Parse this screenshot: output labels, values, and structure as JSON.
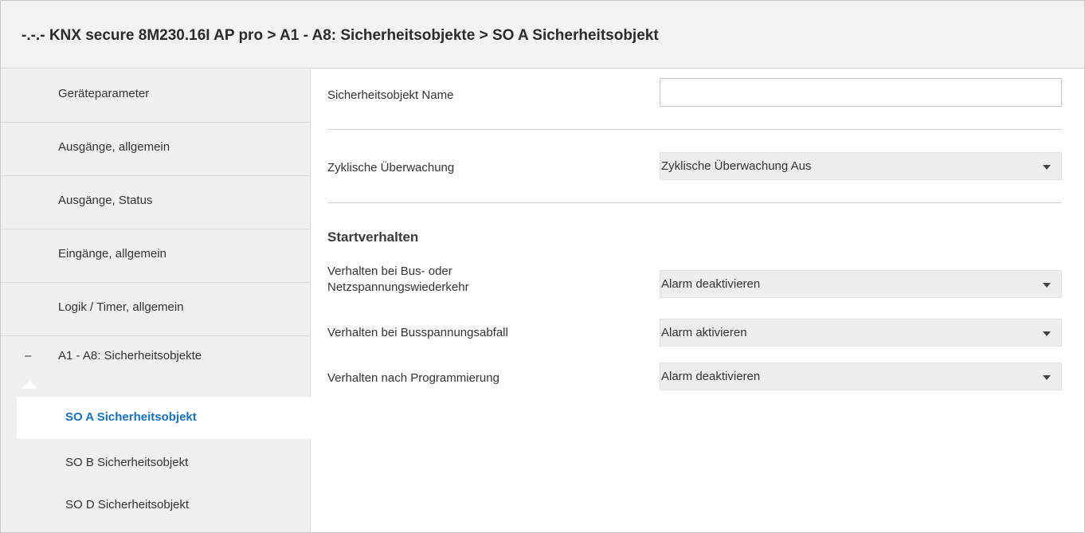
{
  "window": {
    "title": "-.-.- KNX secure 8M230.16I AP pro > A1 - A8: Sicherheitsobjekte > SO A  Sicherheitsobjekt"
  },
  "sidebar": {
    "items": [
      {
        "label": "Geräteparameter"
      },
      {
        "label": "Ausgänge, allgemein"
      },
      {
        "label": "Ausgänge, Status"
      },
      {
        "label": "Eingänge, allgemein"
      },
      {
        "label": "Logik / Timer, allgemein"
      },
      {
        "label": "A1 - A8: Sicherheitsobjekte",
        "collapse_glyph": "–"
      }
    ],
    "sub_items": [
      {
        "label": "SO A  Sicherheitsobjekt",
        "active": true
      },
      {
        "label": "SO B  Sicherheitsobjekt"
      },
      {
        "label": "SO D  Sicherheitsobjekt"
      }
    ]
  },
  "main": {
    "name_label": "Sicherheitsobjekt Name",
    "name_value": "",
    "monitoring_label": "Zyklische Überwachung",
    "monitoring_value": "Zyklische Überwachung Aus",
    "section_title": "Startverhalten",
    "bus_return_label_line1": "Verhalten bei Bus- oder",
    "bus_return_label_line2": "Netzspannungswiederkehr",
    "bus_return_value": "Alarm deaktivieren",
    "bus_drop_label": "Verhalten bei Busspannungsabfall",
    "bus_drop_value": "Alarm aktivieren",
    "after_prog_label": "Verhalten nach Programmierung",
    "after_prog_value": "Alarm deaktivieren"
  },
  "colors": {
    "active_link": "#1a6fb8",
    "sidebar_bg": "#f0f0f0",
    "select_bg": "#eeeeee"
  }
}
